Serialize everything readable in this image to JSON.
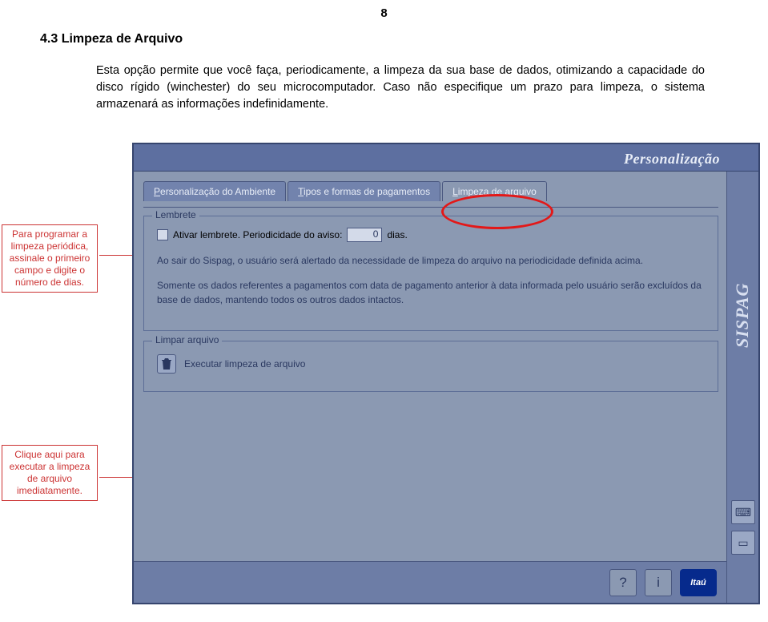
{
  "page_number": "8",
  "section": "4.3  Limpeza de Arquivo",
  "intro": "Esta opção permite que você faça, periodicamente, a limpeza da sua base de dados, otimizando a capacidade do disco rígido (winchester) do seu microcomputador. Caso não especifique um prazo para limpeza, o sistema armazenará as informações indefinidamente.",
  "callouts": {
    "c1": "Para programar a limpeza periódica, assinale o primeiro campo e digite o número de dias.",
    "c2": "Clique aqui para executar a limpeza de arquivo imediatamente."
  },
  "app": {
    "header_title": "Personalização",
    "sidebar_label": "SISPAG",
    "tabs": {
      "t1": "Personalização do Ambiente",
      "t2": "Tipos e formas de pagamentos",
      "t3": "Limpeza de arquivo"
    },
    "lembrete": {
      "legend": "Lembrete",
      "checkbox_label": "Ativar lembrete. Periodicidade do aviso:",
      "days_value": "0",
      "days_suffix": "dias.",
      "p1": "Ao sair do Sispag, o usuário será alertado da necessidade de limpeza do arquivo na periodicidade definida acima.",
      "p2": "Somente os dados referentes a pagamentos com data de pagamento anterior à data informada pelo usuário serão excluídos da base de dados, mantendo todos os outros dados intactos."
    },
    "limpar": {
      "legend": "Limpar arquivo",
      "button": "Executar limpeza de arquivo"
    },
    "bottom": {
      "help": "?",
      "info": "i",
      "logo": "Itaú"
    }
  }
}
